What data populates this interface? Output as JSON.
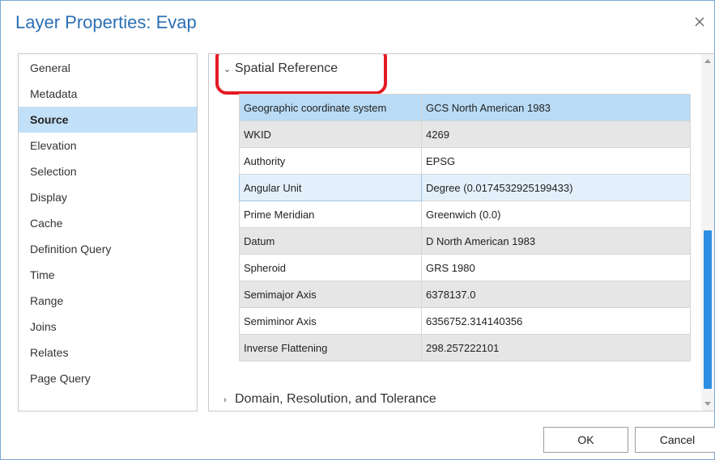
{
  "dialog": {
    "title": "Layer Properties: Evap"
  },
  "nav": {
    "items": [
      {
        "label": "General"
      },
      {
        "label": "Metadata"
      },
      {
        "label": "Source",
        "selected": true
      },
      {
        "label": "Elevation"
      },
      {
        "label": "Selection"
      },
      {
        "label": "Display"
      },
      {
        "label": "Cache"
      },
      {
        "label": "Definition Query"
      },
      {
        "label": "Time"
      },
      {
        "label": "Range"
      },
      {
        "label": "Joins"
      },
      {
        "label": "Relates"
      },
      {
        "label": "Page Query"
      }
    ]
  },
  "section": {
    "spatial_reference": "Spatial Reference",
    "domain": "Domain, Resolution, and Tolerance"
  },
  "properties": [
    {
      "key": "Geographic coordinate system",
      "value": "GCS North American 1983"
    },
    {
      "key": "WKID",
      "value": "4269"
    },
    {
      "key": "Authority",
      "value": "EPSG"
    },
    {
      "key": "Angular Unit",
      "value": "Degree (0.0174532925199433)"
    },
    {
      "key": "Prime Meridian",
      "value": "Greenwich (0.0)"
    },
    {
      "key": "Datum",
      "value": "D North American 1983"
    },
    {
      "key": "Spheroid",
      "value": "GRS 1980"
    },
    {
      "key": "Semimajor Axis",
      "value": "6378137.0"
    },
    {
      "key": "Semiminor Axis",
      "value": "6356752.314140356"
    },
    {
      "key": "Inverse Flattening",
      "value": "298.257222101"
    }
  ],
  "buttons": {
    "ok": "OK",
    "cancel": "Cancel"
  },
  "colors": {
    "title": "#2c6fb3",
    "highlight": "#e31b23",
    "selection": "#c2e0f7",
    "scroll_thumb": "#2c8ee0"
  }
}
